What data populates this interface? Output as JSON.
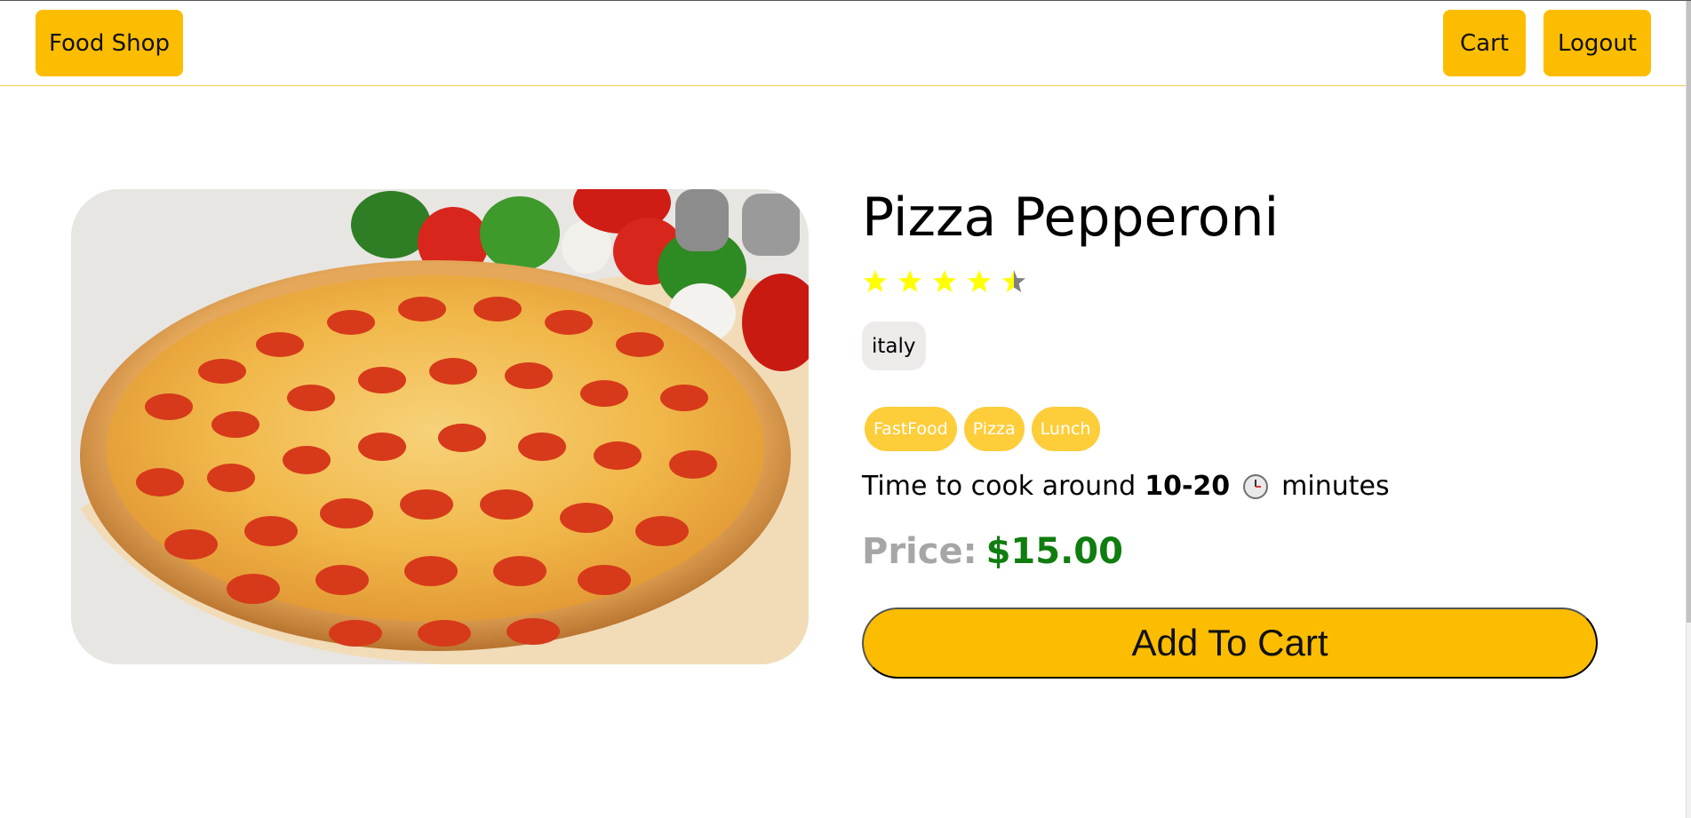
{
  "header": {
    "brand_label": "Food Shop",
    "cart_label": "Cart",
    "logout_label": "Logout"
  },
  "food": {
    "name": "Pizza Pepperoni",
    "rating": 4.5,
    "rating_max": 5,
    "origin": "italy",
    "tags": [
      "FastFood",
      "Pizza",
      "Lunch"
    ],
    "cook_time_prefix": "Time to cook around",
    "cook_time_value": "10-20",
    "cook_time_suffix": "minutes",
    "price_label": "Price:",
    "price_value": "$15.00"
  },
  "actions": {
    "add_to_cart_label": "Add To Cart"
  },
  "colors": {
    "accent": "#fcbd00",
    "tag": "#fdcd3a",
    "star_filled": "#ffff00",
    "star_empty": "#808080",
    "price": "#0f7d0f"
  },
  "icons": {
    "clock": "clock-icon",
    "star": "star-icon"
  }
}
